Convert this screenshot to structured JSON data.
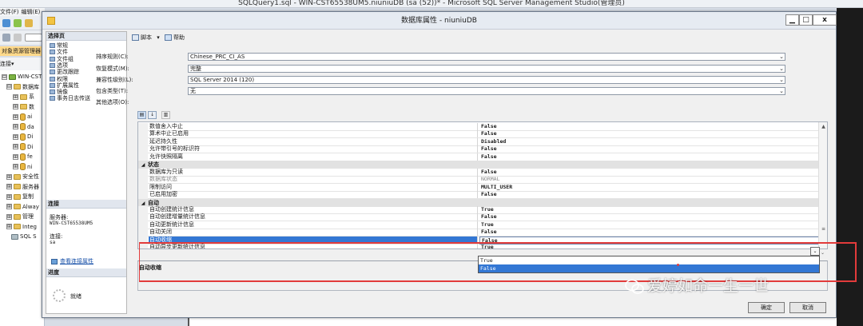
{
  "background_app": {
    "title": "SQLQuery1.sql - WIN-CST65538UM5.niuniuDB (sa (52))* - Microsoft SQL Server Management Studio(管理员)",
    "menu": [
      "文件(F)",
      "编辑(E)"
    ],
    "object_explorer_header": "对象资源管理器",
    "object_explorer_connect": "连接▾",
    "tree": [
      {
        "exp": "⊟",
        "type": "server",
        "label": "WIN-CST"
      },
      {
        "exp": "⊟",
        "type": "folder",
        "label": "数据库"
      },
      {
        "exp": "⊞",
        "type": "folder",
        "label": "系"
      },
      {
        "exp": "⊞",
        "type": "folder",
        "label": "数"
      },
      {
        "exp": "⊞",
        "type": "db",
        "label": "ai"
      },
      {
        "exp": "⊞",
        "type": "db",
        "label": "da"
      },
      {
        "exp": "⊞",
        "type": "db",
        "label": "Di"
      },
      {
        "exp": "⊞",
        "type": "db",
        "label": "Di"
      },
      {
        "exp": "⊞",
        "type": "db",
        "label": "fe"
      },
      {
        "exp": "⊞",
        "type": "db",
        "label": "ni"
      },
      {
        "exp": "⊞",
        "type": "folder",
        "label": "安全性"
      },
      {
        "exp": "⊞",
        "type": "folder",
        "label": "服务器"
      },
      {
        "exp": "⊞",
        "type": "folder",
        "label": "复制"
      },
      {
        "exp": "⊞",
        "type": "folder",
        "label": "Alway"
      },
      {
        "exp": "⊞",
        "type": "folder",
        "label": "管理"
      },
      {
        "exp": "⊞",
        "type": "folder",
        "label": "Integ"
      },
      {
        "exp": "",
        "type": "agent",
        "label": "SQL S"
      }
    ]
  },
  "dialog": {
    "title": "数据库属性 - niuniuDB",
    "window_buttons": {
      "minimize": "▁",
      "maximize": "□",
      "close": "x"
    },
    "pages_header": "选择页",
    "pages": [
      "常规",
      "文件",
      "文件组",
      "选项",
      "更改跟踪",
      "权限",
      "扩展属性",
      "镜像",
      "事务日志传送"
    ],
    "connection_header": "连接",
    "server_label": "服务器:",
    "server_value": "WIN-CST65538UM5",
    "connection_label": "连接:",
    "connection_value": "sa",
    "view_connection_link": "查看连接属性",
    "progress_header": "进度",
    "progress_status": "就绪",
    "toolbar": {
      "script": "脚本",
      "script_arrow": "▾",
      "help": "帮助"
    },
    "fields": [
      {
        "label": "排序规则(C):",
        "value": "Chinese_PRC_CI_AS"
      },
      {
        "label": "恢复模式(M):",
        "value": "完整"
      },
      {
        "label": "兼容性级别(L):",
        "value": "SQL Server 2014 (120)"
      },
      {
        "label": "包含类型(T):",
        "value": "无"
      }
    ],
    "other_options_label": "其他选项(O):",
    "grid_rows": [
      {
        "kind": "row",
        "name": "数值舍入中止",
        "value": "False"
      },
      {
        "kind": "row",
        "name": "算术中止已启用",
        "value": "False"
      },
      {
        "kind": "row",
        "name": "延迟持久性",
        "value": "Disabled"
      },
      {
        "kind": "row",
        "name": "允许带引号的标识符",
        "value": "False"
      },
      {
        "kind": "row",
        "name": "允许快照隔离",
        "value": "False"
      },
      {
        "kind": "cat",
        "name": "状态",
        "toggle": "◢"
      },
      {
        "kind": "row",
        "name": "数据库为只读",
        "value": "False"
      },
      {
        "kind": "row",
        "name": "数据库状态",
        "value": "NORMAL",
        "disabled": true
      },
      {
        "kind": "row",
        "name": "限制访问",
        "value": "MULTI_USER"
      },
      {
        "kind": "row",
        "name": "已启用加密",
        "value": "False"
      },
      {
        "kind": "cat",
        "name": "自动",
        "toggle": "◢"
      },
      {
        "kind": "row",
        "name": "自动创建统计信息",
        "value": "True"
      },
      {
        "kind": "row",
        "name": "自动创建增量统计信息",
        "value": "False"
      },
      {
        "kind": "row",
        "name": "自动更新统计信息",
        "value": "True"
      },
      {
        "kind": "row",
        "name": "自动关闭",
        "value": "False"
      },
      {
        "kind": "row",
        "name": "自动收缩",
        "value": "False",
        "selected": true
      },
      {
        "kind": "row",
        "name": "自动异步更新统计信息",
        "value": "True"
      }
    ],
    "dropdown_options": [
      {
        "label": "True",
        "highlighted": false
      },
      {
        "label": "False",
        "highlighted": true
      }
    ],
    "description_title": "自动收缩",
    "ok_button": "确定",
    "cancel_button": "取消"
  },
  "watermark": {
    "text": "爱婷如命一生一世"
  },
  "colors": {
    "selection": "#3377d4",
    "annotation_red": "#e23b3b",
    "category_bg": "#e2e2e2"
  }
}
